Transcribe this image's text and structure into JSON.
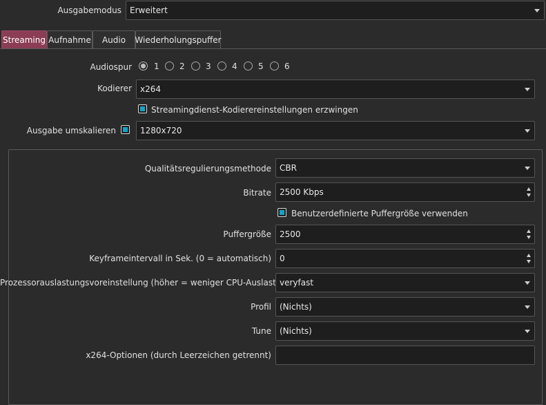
{
  "output_mode": {
    "label": "Ausgabemodus",
    "value": "Erweitert"
  },
  "tabs": [
    {
      "label": "Streaming",
      "active": true
    },
    {
      "label": "Aufnahme",
      "active": false
    },
    {
      "label": "Audio",
      "active": false
    },
    {
      "label": "Wiederholungspuffer",
      "active": false
    }
  ],
  "audio_track": {
    "label": "Audiospur",
    "options": [
      "1",
      "2",
      "3",
      "4",
      "5",
      "6"
    ],
    "selected": "1"
  },
  "encoder": {
    "label": "Kodierer",
    "value": "x264"
  },
  "enforce_encoder_settings": {
    "label": "Streamingdienst-Kodierereinstellungen erzwingen",
    "checked": true
  },
  "rescale_output": {
    "label": "Ausgabe umskalieren",
    "checked": true,
    "value": "1280x720"
  },
  "rate_control": {
    "label": "Qualitätsregulierungsmethode",
    "value": "CBR"
  },
  "bitrate": {
    "label": "Bitrate",
    "value": "2500 Kbps"
  },
  "custom_buffer": {
    "label": "Benutzerdefinierte Puffergröße verwenden",
    "checked": true
  },
  "buffer_size": {
    "label": "Puffergröße",
    "value": "2500"
  },
  "keyframe_interval": {
    "label": "Keyframeintervall in Sek. (0 = automatisch)",
    "value": "0"
  },
  "cpu_preset": {
    "label": "Prozessorauslastungsvoreinstellung (höher = weniger CPU-Auslastung)",
    "value": "veryfast"
  },
  "profile": {
    "label": "Profil",
    "value": "(Nichts)"
  },
  "tune": {
    "label": "Tune",
    "value": "(Nichts)"
  },
  "x264_options": {
    "label": "x264-Optionen (durch Leerzeichen getrennt)",
    "value": ""
  },
  "colors": {
    "background": "#2b2b2b",
    "field_background": "#1e1e1e",
    "active_tab": "#8a3d55",
    "checkbox_accent": "#17a2c8"
  }
}
